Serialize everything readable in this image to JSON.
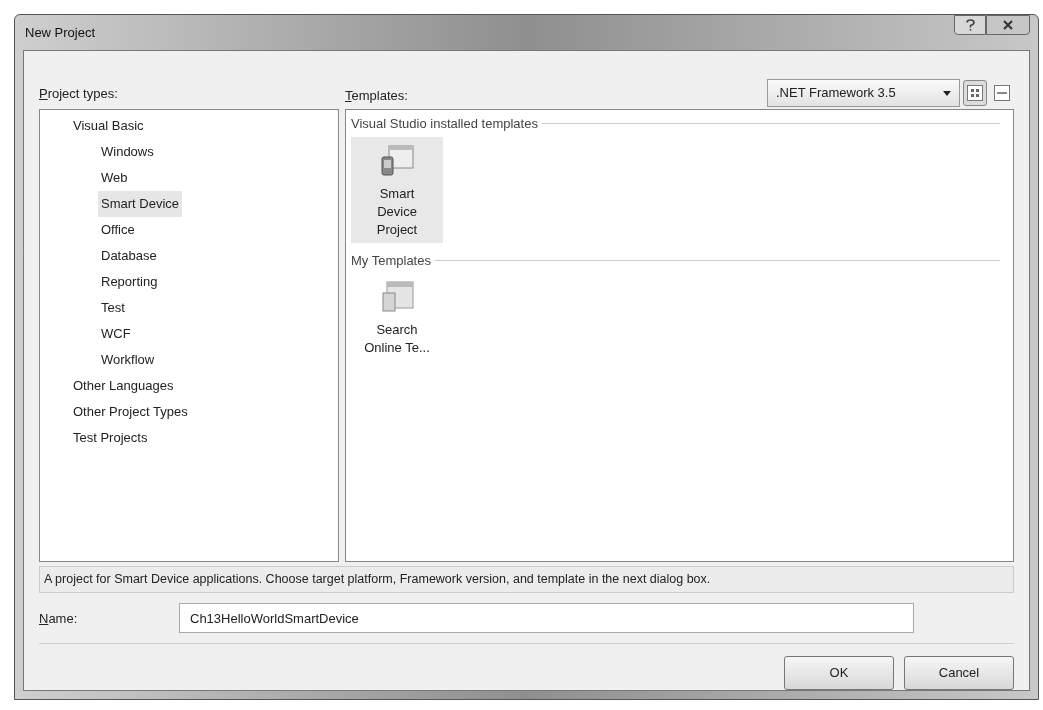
{
  "window": {
    "title": "New Project"
  },
  "project_types": {
    "label": "Project types:",
    "items": [
      {
        "label": "Visual Basic",
        "selected": false,
        "children": [
          {
            "label": "Windows",
            "selected": false
          },
          {
            "label": "Web",
            "selected": false
          },
          {
            "label": "Smart Device",
            "selected": true
          },
          {
            "label": "Office",
            "selected": false
          },
          {
            "label": "Database",
            "selected": false
          },
          {
            "label": "Reporting",
            "selected": false
          },
          {
            "label": "Test",
            "selected": false
          },
          {
            "label": "WCF",
            "selected": false
          },
          {
            "label": "Workflow",
            "selected": false
          }
        ]
      },
      {
        "label": "Other Languages",
        "selected": false
      },
      {
        "label": "Other Project Types",
        "selected": false
      },
      {
        "label": "Test Projects",
        "selected": false
      }
    ]
  },
  "templates": {
    "label": "Templates:",
    "framework": ".NET Framework 3.5",
    "views": [
      {
        "kind": "large",
        "selected": true
      },
      {
        "kind": "small",
        "selected": false
      }
    ],
    "groups": [
      {
        "title": "Visual Studio installed templates",
        "items": [
          {
            "label": "Smart Device Project",
            "kind": "device",
            "selected": true
          }
        ]
      },
      {
        "title": "My Templates",
        "items": [
          {
            "label": "Search Online Te...",
            "kind": "search",
            "selected": false
          }
        ]
      }
    ]
  },
  "description": "A project for Smart Device applications. Choose target platform, Framework version, and template in the next dialog box.",
  "name_field": {
    "label": "Name:",
    "value": "Ch13HelloWorldSmartDevice"
  },
  "buttons": [
    {
      "label": "OK"
    },
    {
      "label": "Cancel"
    }
  ]
}
